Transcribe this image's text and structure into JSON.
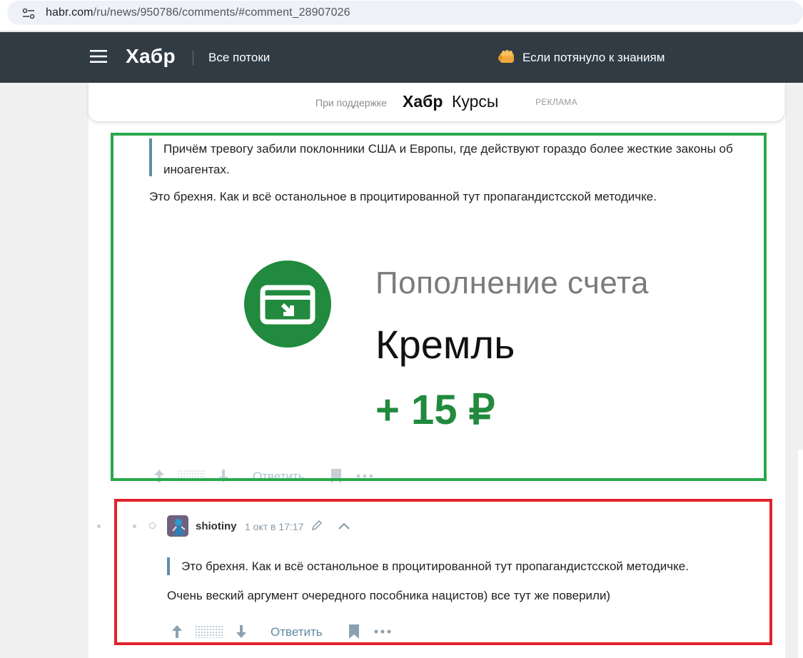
{
  "browser": {
    "url_host": "habr.com",
    "url_path": "/ru/news/950786/comments/#comment_28907026"
  },
  "header": {
    "logo": "Хабр",
    "nav_all_flows": "Все потоки",
    "promo_text": "Если потянуло к знаниям"
  },
  "sponsor": {
    "label": "При поддержке",
    "brand_bold": "Хабр",
    "brand_rest": "Курсы",
    "ad_tag": "РЕКЛАМА"
  },
  "comment1": {
    "quote": "Причём тревогу забили поклонники США и Европы, где действуют гораздо более жесткие законы об иноагентах.",
    "text": "Это брехня. Как и всё останольное в процитированной тут пропагандистсской методичке.",
    "image": {
      "title": "Пополнение счета",
      "payee": "Кремль",
      "amount": "+ 15 ₽"
    },
    "reply_label": "Ответить"
  },
  "comment2": {
    "author": "shiotiny",
    "timestamp": "1 окт в 17:17",
    "quote": "Это брехня. Как и всё останольное в процитированной тут пропагандистсской методичке.",
    "text": "Очень веский аргумент очередного пособника нацистов) все тут же поверили)",
    "reply_label": "Ответить"
  },
  "colors": {
    "header_bg": "#303b44",
    "accent_link": "#5e8aa3",
    "quote_bar": "#5f8ea3",
    "green_frame": "#2aa84a",
    "red_frame": "#e0222d",
    "receipt_green": "#218a3e"
  }
}
